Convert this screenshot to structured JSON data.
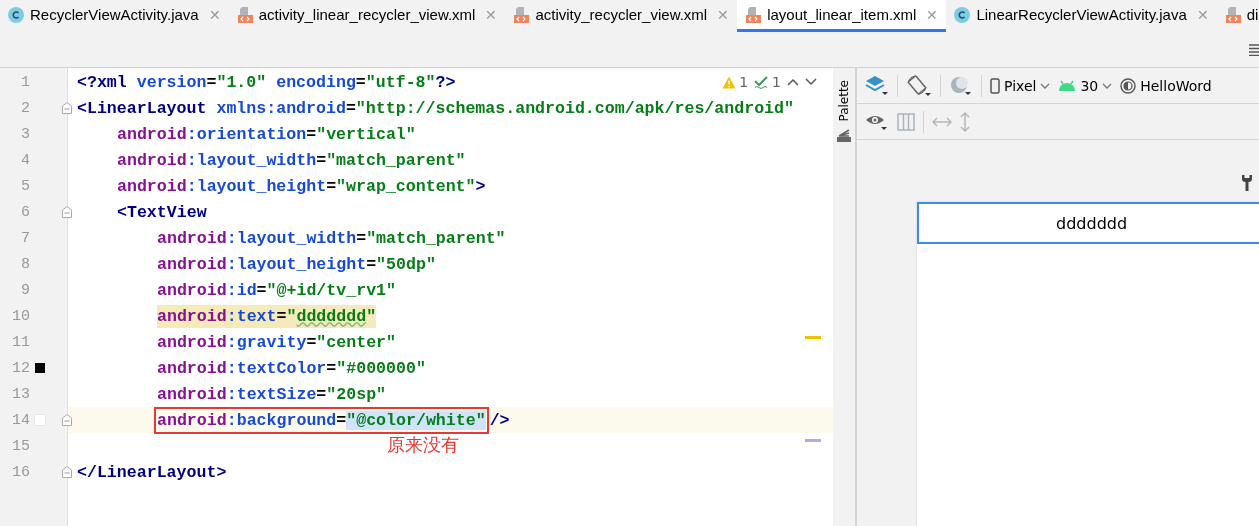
{
  "tabs": [
    {
      "label": "RecyclerViewActivity.java",
      "kind": "java",
      "close": "✕",
      "selected": false
    },
    {
      "label": "activity_linear_recycler_view.xml",
      "kind": "xml",
      "close": "✕",
      "selected": false
    },
    {
      "label": "activity_recycler_view.xml",
      "kind": "xml",
      "close": "✕",
      "selected": false
    },
    {
      "label": "layout_linear_item.xml",
      "kind": "xml",
      "close": "✕",
      "selected": true
    },
    {
      "label": "LinearRecyclerViewActivity.java",
      "kind": "java",
      "close": "✕",
      "selected": false
    },
    {
      "label": "di",
      "kind": "xml",
      "selected": false
    }
  ],
  "editor": {
    "inspections": {
      "warnings": "1",
      "typos": "1"
    },
    "lines": [
      {
        "number": "1",
        "kind": "outer",
        "segments": [
          {
            "kind": "plain",
            "tokens": [
              {
                "kind": "tag",
                "text": "<?xml "
              },
              {
                "kind": "attr",
                "text": "version"
              },
              {
                "kind": "punct",
                "text": "="
              },
              {
                "kind": "value",
                "text": "\"1.0\" "
              },
              {
                "kind": "attr",
                "text": "encoding"
              },
              {
                "kind": "punct",
                "text": "="
              },
              {
                "kind": "value",
                "text": "\"utf-8\""
              },
              {
                "kind": "tag",
                "text": "?>"
              }
            ]
          }
        ]
      },
      {
        "number": "2",
        "kind": "outer",
        "fold": true,
        "segments": [
          {
            "kind": "plain",
            "tokens": [
              {
                "kind": "tag",
                "text": "<LinearLayout "
              },
              {
                "kind": "attr",
                "text": "xmlns:android"
              },
              {
                "kind": "punct",
                "text": "="
              },
              {
                "kind": "value",
                "text": "\"http://schemas.android.com/apk/res/android\""
              }
            ]
          }
        ]
      },
      {
        "number": "3",
        "kind": "middle",
        "segments": [
          {
            "kind": "plain",
            "tokens": [
              {
                "kind": "ns",
                "text": "android"
              },
              {
                "kind": "attr",
                "text": ":orientation"
              },
              {
                "kind": "punct",
                "text": "="
              },
              {
                "kind": "value",
                "text": "\"vertical\""
              }
            ]
          }
        ]
      },
      {
        "number": "4",
        "kind": "middle",
        "segments": [
          {
            "kind": "plain",
            "tokens": [
              {
                "kind": "ns",
                "text": "android"
              },
              {
                "kind": "attr",
                "text": ":layout_width"
              },
              {
                "kind": "punct",
                "text": "="
              },
              {
                "kind": "value",
                "text": "\"match_parent\""
              }
            ]
          }
        ]
      },
      {
        "number": "5",
        "kind": "middle",
        "segments": [
          {
            "kind": "plain",
            "tokens": [
              {
                "kind": "ns",
                "text": "android"
              },
              {
                "kind": "attr",
                "text": ":layout_height"
              },
              {
                "kind": "punct",
                "text": "="
              },
              {
                "kind": "value",
                "text": "\"wrap_content\""
              },
              {
                "kind": "tag",
                "text": ">"
              }
            ]
          }
        ]
      },
      {
        "number": "6",
        "kind": "middle",
        "fold": true,
        "segments": [
          {
            "kind": "plain",
            "tokens": [
              {
                "kind": "tag",
                "text": "<TextView"
              }
            ]
          }
        ]
      },
      {
        "number": "7",
        "kind": "inner",
        "segments": [
          {
            "kind": "plain",
            "tokens": [
              {
                "kind": "ns",
                "text": "android"
              },
              {
                "kind": "attr",
                "text": ":layout_width"
              },
              {
                "kind": "punct",
                "text": "="
              },
              {
                "kind": "value",
                "text": "\"match_parent\""
              }
            ]
          }
        ]
      },
      {
        "number": "8",
        "kind": "inner",
        "segments": [
          {
            "kind": "plain",
            "tokens": [
              {
                "kind": "ns",
                "text": "android"
              },
              {
                "kind": "attr",
                "text": ":layout_height"
              },
              {
                "kind": "punct",
                "text": "="
              },
              {
                "kind": "value",
                "text": "\"50dp\""
              }
            ]
          }
        ]
      },
      {
        "number": "9",
        "kind": "inner",
        "segments": [
          {
            "kind": "plain",
            "tokens": [
              {
                "kind": "ns",
                "text": "android"
              },
              {
                "kind": "attr",
                "text": ":id"
              },
              {
                "kind": "punct",
                "text": "="
              },
              {
                "kind": "value",
                "text": "\"@+id/tv_rv1\""
              }
            ]
          }
        ]
      },
      {
        "number": "10",
        "kind": "inner",
        "segments": [
          {
            "kind": "highlighted",
            "tokens": [
              {
                "kind": "ns",
                "text": "android"
              },
              {
                "kind": "attr",
                "text": ":text"
              },
              {
                "kind": "punct",
                "text": "="
              },
              {
                "kind": "value",
                "text": "\""
              },
              {
                "kind": "typo",
                "text": "ddddddd"
              },
              {
                "kind": "value",
                "text": "\""
              }
            ]
          }
        ]
      },
      {
        "number": "11",
        "kind": "inner",
        "segments": [
          {
            "kind": "plain",
            "tokens": [
              {
                "kind": "ns",
                "text": "android"
              },
              {
                "kind": "attr",
                "text": ":gravity"
              },
              {
                "kind": "punct",
                "text": "="
              },
              {
                "kind": "value",
                "text": "\"center\""
              }
            ]
          }
        ]
      },
      {
        "number": "12",
        "kind": "inner",
        "color": "#000000",
        "segments": [
          {
            "kind": "plain",
            "tokens": [
              {
                "kind": "ns",
                "text": "android"
              },
              {
                "kind": "attr",
                "text": ":textColor"
              },
              {
                "kind": "punct",
                "text": "="
              },
              {
                "kind": "value",
                "text": "\"#000000\""
              }
            ]
          }
        ]
      },
      {
        "number": "13",
        "kind": "inner",
        "segments": [
          {
            "kind": "plain",
            "tokens": [
              {
                "kind": "ns",
                "text": "android"
              },
              {
                "kind": "attr",
                "text": ":textSize"
              },
              {
                "kind": "punct",
                "text": "="
              },
              {
                "kind": "value",
                "text": "\"20sp\""
              }
            ]
          }
        ]
      },
      {
        "number": "14",
        "kind": "inner",
        "color": "#ffffff",
        "fold": true,
        "current": true,
        "note": "原来没有",
        "segments": [
          {
            "kind": "boxed",
            "tokens": [
              {
                "kind": "ns",
                "text": "android"
              },
              {
                "kind": "attr",
                "text": ":background"
              },
              {
                "kind": "punct",
                "text": "="
              },
              {
                "kind": "selection",
                "text": "\"@color/white\""
              }
            ]
          },
          {
            "kind": "plain",
            "tokens": [
              {
                "kind": "tag",
                "text": "/>"
              }
            ]
          }
        ]
      },
      {
        "number": "15",
        "kind": "outer"
      },
      {
        "number": "16",
        "kind": "outer",
        "fold": true,
        "segments": [
          {
            "kind": "plain",
            "tokens": [
              {
                "kind": "tag",
                "text": "</LinearLayout>"
              }
            ]
          }
        ]
      }
    ]
  },
  "design": {
    "palette_label": "Palette",
    "device": "Pixel",
    "api": "30",
    "theme": "HelloWord",
    "preview_text": "ddddddd"
  }
}
